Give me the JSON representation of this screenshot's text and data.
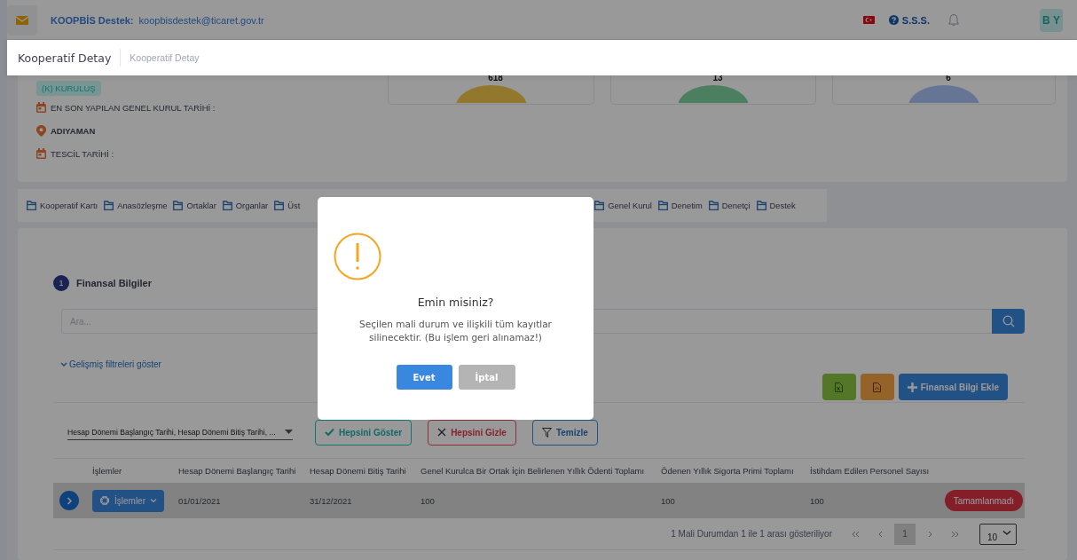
{
  "header": {
    "support_label": "KOOPBİS Destek:",
    "support_email": "koopbisdestek@ticaret.gov.tr",
    "faq": "S.S.S.",
    "avatar": "B Y"
  },
  "page_header": {
    "title": "Kooperatif Detay",
    "breadcrumb": "Kooperatif Detay"
  },
  "summary": {
    "status_badge": "(K) KURULUŞ",
    "fields": [
      {
        "kind": "date",
        "text": "EN SON YAPILAN GENEL KURUL TARİHİ :"
      },
      {
        "kind": "location",
        "text": "ADIYAMAN"
      },
      {
        "kind": "date",
        "text": "TESCİL TARİHİ :"
      }
    ],
    "stat_cards": [
      {
        "value": "618"
      },
      {
        "value": "13"
      },
      {
        "value": "6"
      }
    ]
  },
  "tabs": [
    "Kooperatif Kartı",
    "Anasözleşme",
    "Ortaklar",
    "Organlar",
    "Üst",
    "Genel Kurul",
    "Denetim",
    "Denetçi",
    "Destek"
  ],
  "section": {
    "step": "1",
    "title": "Finansal Bilgiler",
    "search_placeholder": "Ara...",
    "advanced_filters": "Gelişmiş filtreleri göster",
    "add_button": "Finansal Bilgi Ekle",
    "column_select": "Hesap Dönemi Başlangıç Tarihi, Hesap Dönemi Bitiş Tarihi, ...",
    "filter_buttons": [
      {
        "kind": "show",
        "label": "Hepsini Göster"
      },
      {
        "kind": "hide",
        "label": "Hepsini Gizle"
      },
      {
        "kind": "clear",
        "label": "Temizle"
      }
    ]
  },
  "table": {
    "columns": [
      "",
      "İşlemler",
      "Hesap Dönemi Başlangıç Tarihi",
      "Hesap Dönemi Bitiş Tarihi",
      "Genel Kurulca Bir Ortak İçin Belirlenen Yıllık Ödenti Toplamı",
      "Ödenen Yıllık Sigorta Primi Toplamı",
      "İstihdam Edilen Personel Sayısı"
    ],
    "rows": [
      {
        "selected": true,
        "cells": [
          "",
          "İşlemler",
          "01/01/2021",
          "31/12/2021",
          "100",
          "100",
          "100"
        ],
        "status": "Tamamlanmadı"
      }
    ]
  },
  "pagination": {
    "summary": "1 Mali Durumdan 1 ile 1 arası gösteriliyor",
    "pages": [
      {
        "label": "1",
        "selected": true
      }
    ],
    "page_size": "10"
  },
  "modal": {
    "title": "Emin misiniz?",
    "message": "Seçilen mali durum ve ilişkili tüm kayıtlar silinecektir. (Bu işlem geri alınamaz!)",
    "confirm": "Evet",
    "cancel": "İptal"
  }
}
